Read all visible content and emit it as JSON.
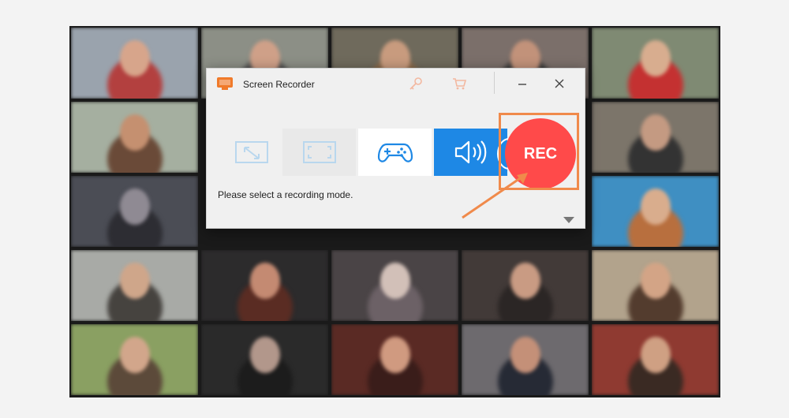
{
  "window": {
    "title": "Screen Recorder"
  },
  "icons": {
    "app": "screen-recorder-app-icon",
    "key": "key-icon",
    "cart": "shopping-cart-icon",
    "minimize": "minimize-icon",
    "close": "close-icon",
    "region": "region-select-icon",
    "fullscreen": "fullscreen-icon",
    "game": "gamepad-icon",
    "audio": "speaker-icon",
    "expand": "triangle-down-icon"
  },
  "modes": {
    "rec_label": "REC"
  },
  "status": {
    "hint": "Please select a recording mode."
  },
  "colors": {
    "accent_blue": "#1e88e5",
    "rec_red": "#ff4a4a",
    "annotation_orange": "#f08a4b",
    "icon_orange": "#f07a2a"
  }
}
